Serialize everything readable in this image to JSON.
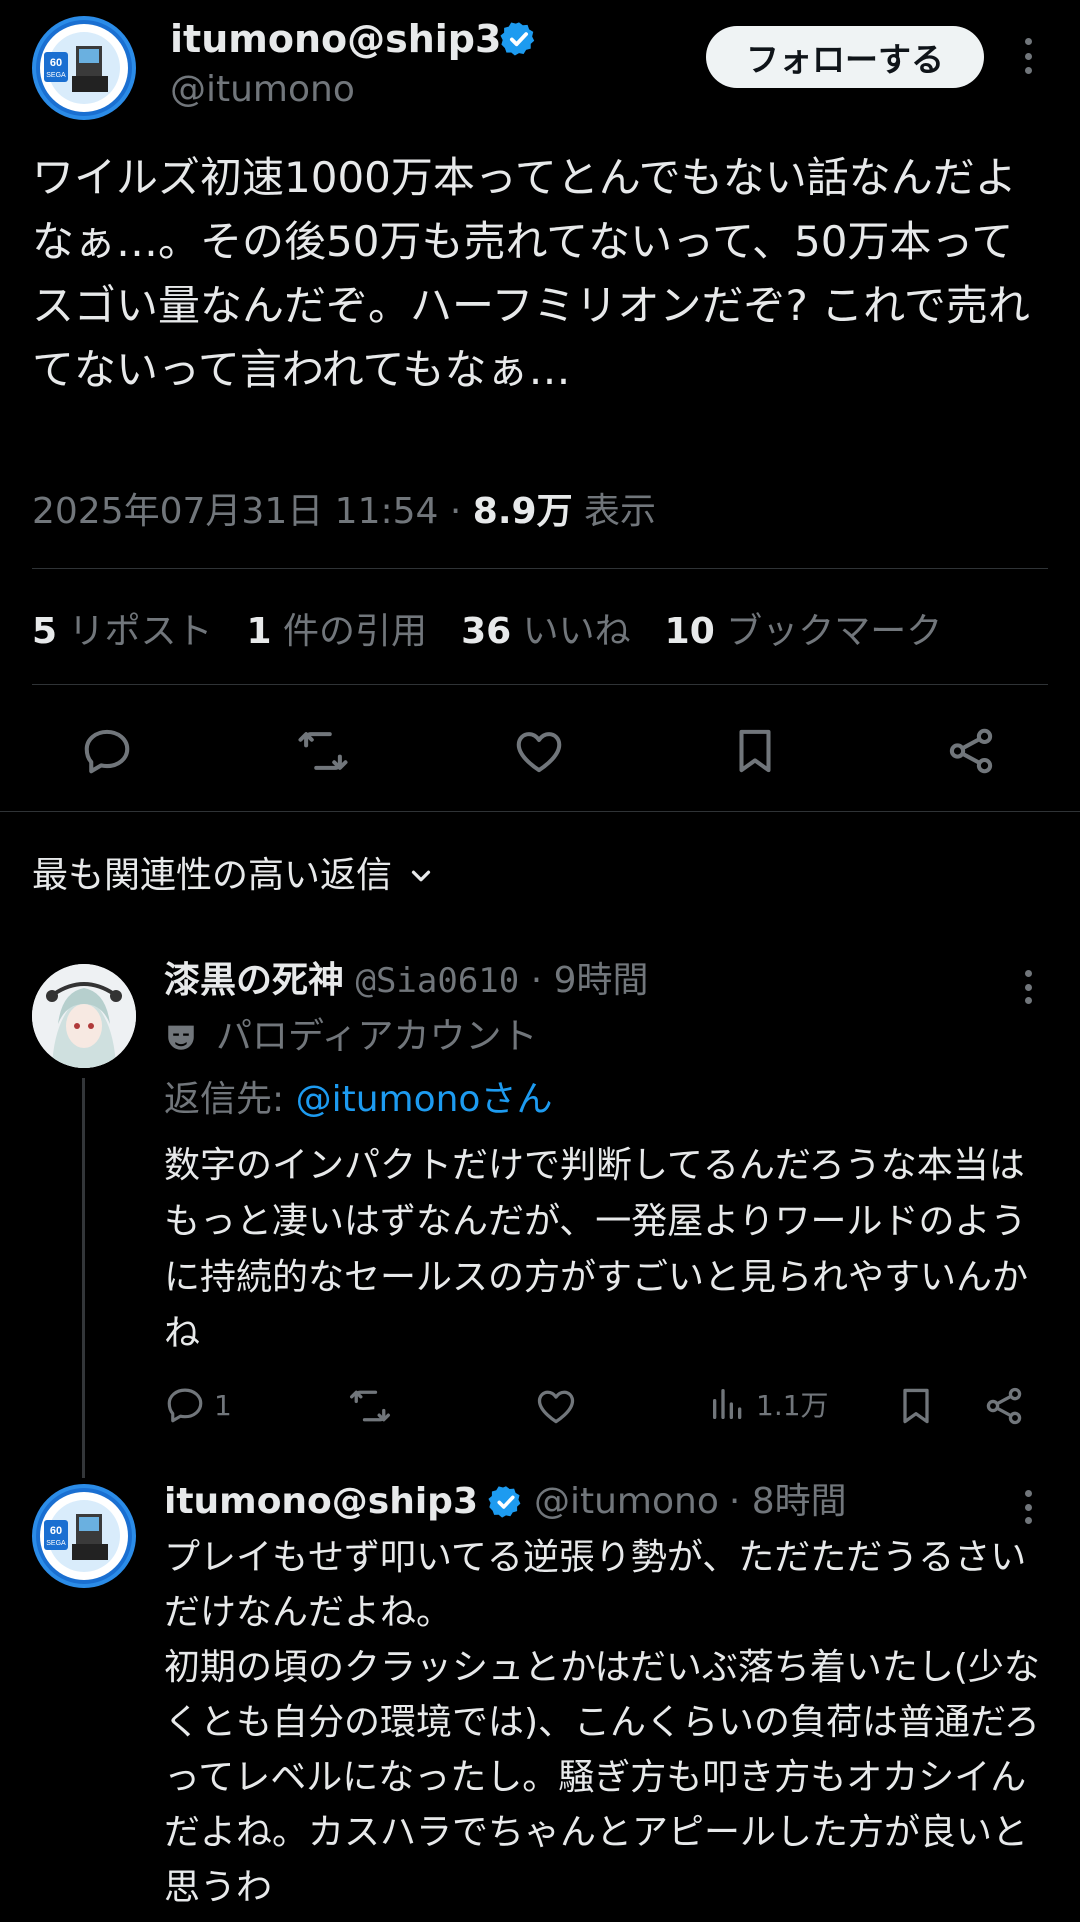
{
  "main_tweet": {
    "author_name": "itumono@ship3",
    "author_handle": "@itumono",
    "follow_label": "フォローする",
    "body": "ワイルズ初速1000万本ってとんでもない話なんだよなぁ…。その後50万も売れてないって、50万本ってスゴい量なんだぞ。ハーフミリオンだぞ? これで売れてないって言われてもなぁ…",
    "timestamp": "2025年07月31日 11:54",
    "separator": "·",
    "views_count": "8.9万",
    "views_label": "表示",
    "stats": [
      {
        "count": "5",
        "label": "リポスト"
      },
      {
        "count": "1",
        "label": "件の引用"
      },
      {
        "count": "36",
        "label": "いいね"
      },
      {
        "count": "10",
        "label": "ブックマーク"
      }
    ],
    "actions": [
      "reply-icon",
      "repost-icon",
      "like-icon",
      "bookmark-icon",
      "share-icon"
    ]
  },
  "replies_sort": {
    "label": "最も関連性の高い返信"
  },
  "replies": [
    {
      "author_name": "漆黒の死神",
      "author_handle": "@Sia0610",
      "time": "· 9時間",
      "badge_label": "パロディアカウント",
      "reply_to_prefix": "返信先: ",
      "reply_to_handle": "@itumonoさん",
      "body": "数字のインパクトだけで判断してるんだろうな本当はもっと凄いはずなんだが、一発屋よりワールドのように持続的なセールスの方がすごいと見られやすいんかね",
      "reply_count": "1",
      "views": "1.1万"
    },
    {
      "author_name": "itumono@ship3",
      "author_handle": "@itumono",
      "time": "· 8時間",
      "body_lines": [
        "プレイもせず叩いてる逆張り勢が、ただただうるさいだけなんだよね。",
        "初期の頃のクラッシュとかはだいぶ落ち着いたし(少なくとも自分の環境では)、こんくらいの負荷は普通だろってレベルになったし。騒ぎ方も叩き方もオカシイんだよね。カスハラでちゃんとアピールした方が良いと思うわ"
      ]
    }
  ],
  "colors": {
    "background": "#000000",
    "text": "#e7e9ea",
    "muted": "#71767b",
    "link": "#1d9bf0",
    "verified": "#1d9bf0",
    "divider": "#2f3336"
  }
}
